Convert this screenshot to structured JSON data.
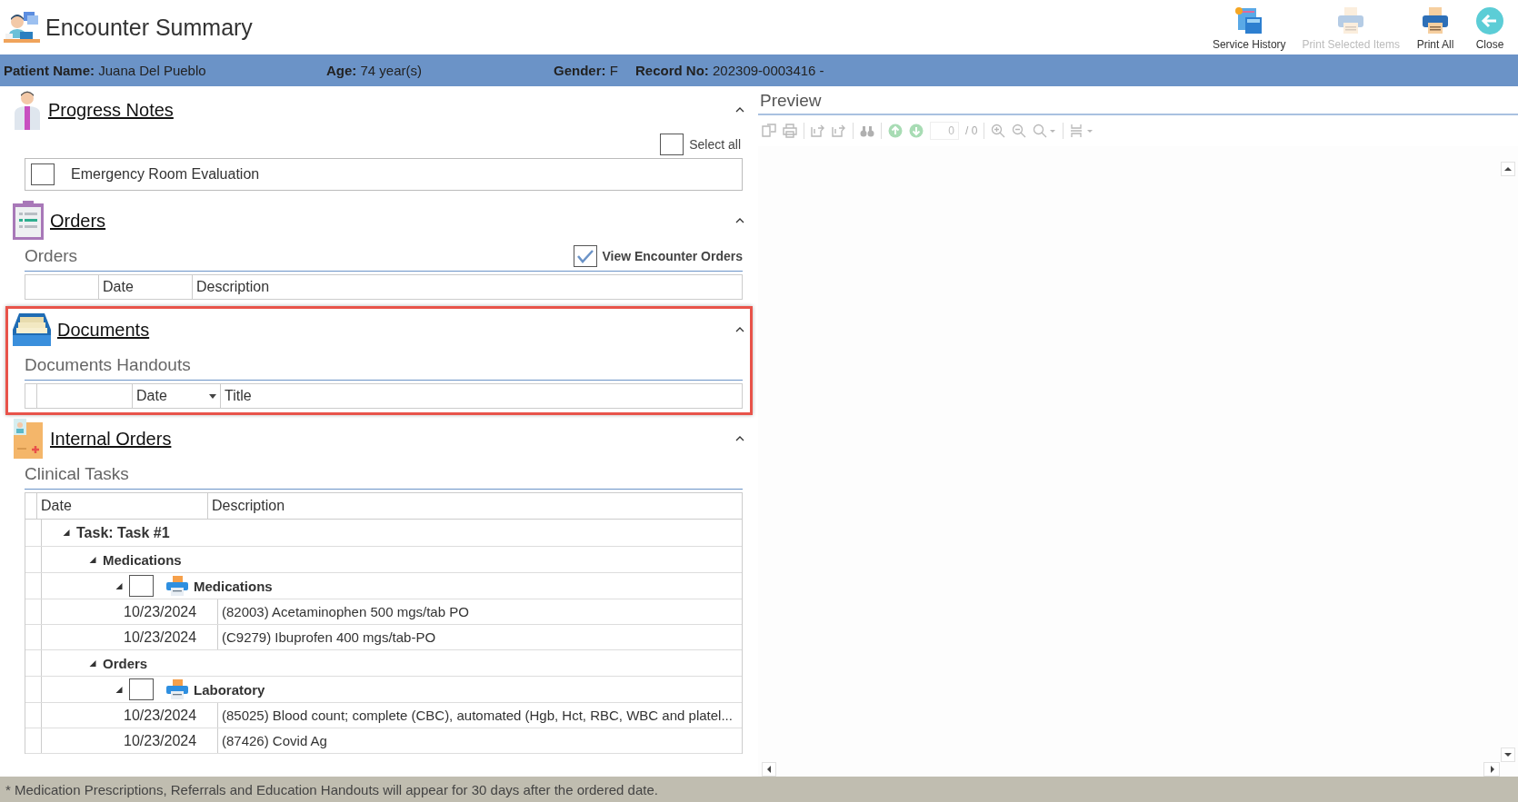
{
  "window": {
    "title": "Encounter Summary"
  },
  "toolbar": [
    {
      "label": "Service History",
      "kind": "history",
      "disabled": false
    },
    {
      "label": "Print Selected Items",
      "kind": "print",
      "disabled": true
    },
    {
      "label": "Print All",
      "kind": "print",
      "disabled": false
    },
    {
      "label": "Close",
      "kind": "close",
      "disabled": false
    }
  ],
  "patient_bar": [
    {
      "label": "Patient Name:",
      "value": "Juana Del Pueblo"
    },
    {
      "label": "Age:",
      "value": "74 year(s)"
    },
    {
      "label": "Gender:",
      "value": "F"
    },
    {
      "label": "Record No:",
      "value": "202309-0003416 -"
    }
  ],
  "progress_notes": {
    "title": "Progress Notes",
    "expanded": true,
    "highlighted": false,
    "select_all": {
      "label": "Select all",
      "checked": false
    },
    "notes": [
      {
        "label": "Emergency Room Evaluation",
        "checked": false
      }
    ]
  },
  "orders": {
    "title": "Orders",
    "expanded": true,
    "highlighted": false,
    "subtitle": "Orders",
    "view_encounter_orders": {
      "label": "View Encounter Orders",
      "checked": true
    },
    "columns": [
      "Date",
      "Description"
    ]
  },
  "documents": {
    "title": "Documents",
    "expanded": true,
    "highlighted": true,
    "subtitle": "Documents Handouts",
    "columns": [
      "Date",
      "Title"
    ]
  },
  "internal_orders": {
    "title": "Internal Orders",
    "expanded": true,
    "highlighted": false,
    "subtitle": "Clinical Tasks",
    "columns": [
      "Date",
      "Description"
    ],
    "tree": [
      {
        "kind": "task",
        "label": "Task: Task #1",
        "expanded": true,
        "children": [
          {
            "kind": "group",
            "label": "Medications",
            "expanded": true,
            "children": [
              {
                "kind": "checkable",
                "label": "Medications",
                "expanded": true,
                "checked": false,
                "children": [
                  {
                    "kind": "item",
                    "date": "10/23/2024",
                    "description": "(82003) Acetaminophen 500 mgs/tab PO"
                  },
                  {
                    "kind": "item",
                    "date": "10/23/2024",
                    "description": "(C9279) Ibuprofen 400 mgs/tab-PO"
                  }
                ]
              }
            ]
          },
          {
            "kind": "group",
            "label": "Orders",
            "expanded": true,
            "children": [
              {
                "kind": "checkable",
                "label": "Laboratory",
                "expanded": true,
                "checked": false,
                "children": [
                  {
                    "kind": "item",
                    "date": "10/23/2024",
                    "description": "(85025) Blood count; complete (CBC), automated (Hgb, Hct, RBC, WBC and platel..."
                  },
                  {
                    "kind": "item",
                    "date": "10/23/2024",
                    "description": "(87426) Covid Ag"
                  }
                ]
              }
            ]
          }
        ]
      }
    ]
  },
  "preview": {
    "title": "Preview",
    "page": "0",
    "page_count": "/ 0"
  },
  "footer_note": "* Medication Prescriptions, Referrals and Education Handouts will appear for 30 days after the ordered date."
}
